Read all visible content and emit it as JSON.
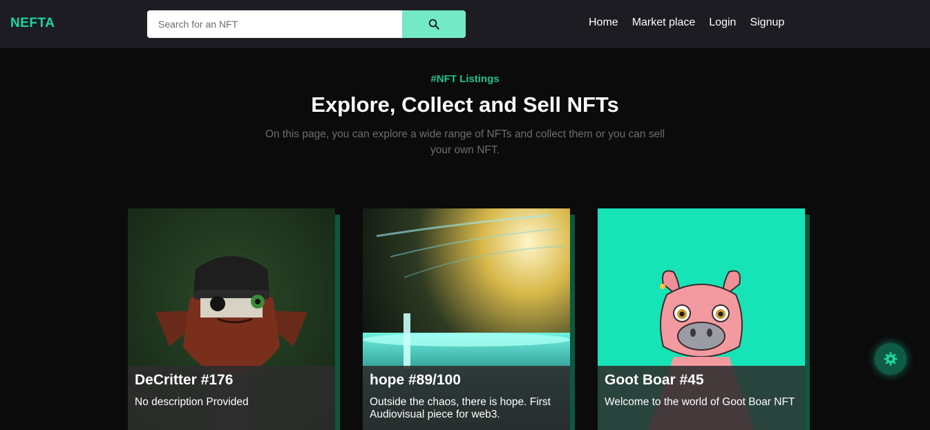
{
  "header": {
    "logo": "NEFTA",
    "search": {
      "placeholder": "Search for an NFT",
      "value": "",
      "icon": "search-icon"
    },
    "nav": [
      "Home",
      "Market place",
      "Login",
      "Signup"
    ]
  },
  "hero": {
    "tag": "#NFT Listings",
    "title": "Explore, Collect and Sell NFTs",
    "subtitle": "On this page, you can explore a wide range of NFTs and collect them or you can sell your own NFT."
  },
  "cards": [
    {
      "title": "DeCritter #176",
      "description": "No description Provided",
      "image": "decritter-art"
    },
    {
      "title": "hope #89/100",
      "description": "Outside the chaos, there is hope. First Audiovisual piece for web3.",
      "image": "hope-cosmic-art"
    },
    {
      "title": "Goot Boar #45",
      "description": "Welcome to the world of Goot Boar NFT",
      "image": "goot-boar-art"
    }
  ],
  "colors": {
    "accent": "#1fd5a2",
    "search_button": "#74e9c5",
    "card_shadow": "#0c5840",
    "navbar": "#1c1c22",
    "background": "#0b0b0c"
  },
  "fab": {
    "icon": "gear-icon"
  }
}
